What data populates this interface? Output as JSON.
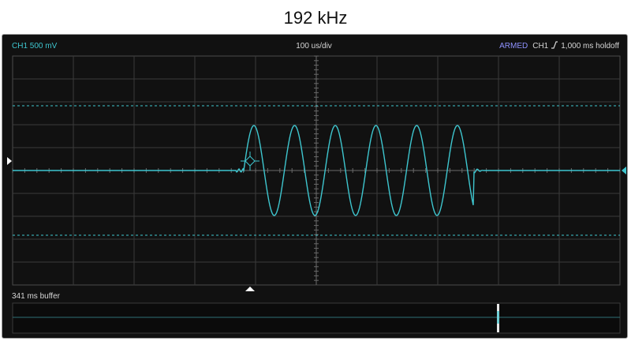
{
  "title": "192 kHz",
  "scope": {
    "channel_label": "CH1 500 mV",
    "timebase_label": "100 us/div",
    "trigger_state": "ARMED",
    "trigger_channel": "CH1",
    "trigger_edge_icon": "rising-edge-icon",
    "holdoff_label": "1,000 ms holdoff",
    "buffer_label": "341 ms buffer"
  },
  "colors": {
    "trace": "#3ec6cf",
    "armed": "#8f92ff",
    "grid": "#3a3a3a",
    "background": "#111111"
  },
  "icons": {
    "left_marker": "ground-reference-marker-icon",
    "right_marker": "trigger-level-marker-icon",
    "trigger_point": "trigger-crosshair-icon",
    "bottom_marker": "trigger-position-marker-icon"
  }
}
